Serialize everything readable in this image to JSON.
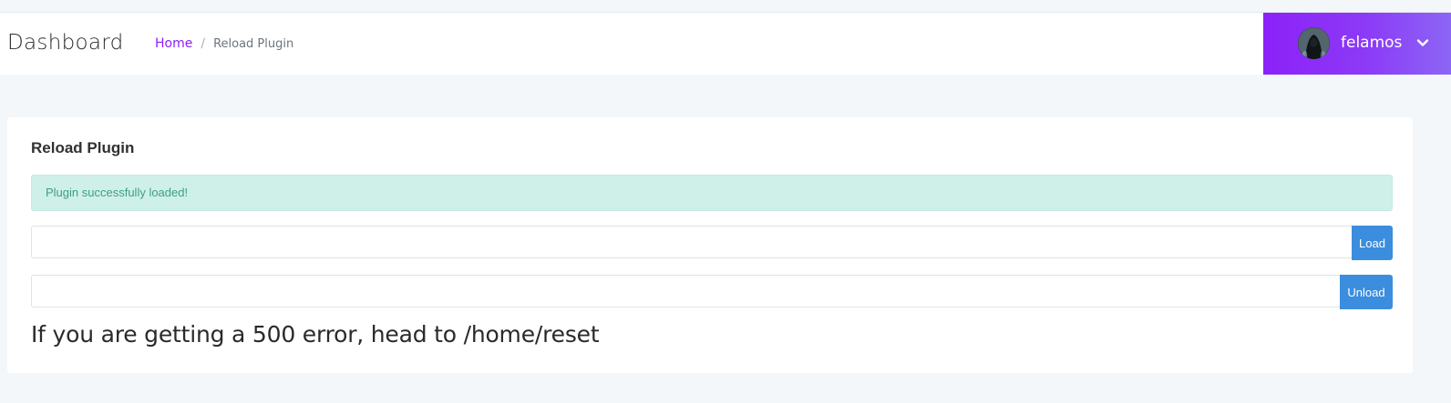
{
  "header": {
    "title": "Dashboard",
    "breadcrumb": {
      "home": "Home",
      "separator": "/",
      "current": "Reload Plugin"
    },
    "user": {
      "name": "felamos",
      "avatar_icon": "avatar",
      "dropdown_icon": "chevron-down-icon"
    }
  },
  "card": {
    "title": "Reload Plugin",
    "alert": "Plugin successfully loaded!",
    "load_input": {
      "value": "",
      "placeholder": ""
    },
    "load_button": "Load",
    "unload_input": {
      "value": "",
      "placeholder": ""
    },
    "unload_button": "Unload",
    "hint": "If you are getting a 500 error, head to /home/reset"
  },
  "colors": {
    "accent": "#8d1ff5",
    "alert_bg": "#cff0e8",
    "alert_text": "#3d9e86",
    "button": "#3b8ddd"
  }
}
